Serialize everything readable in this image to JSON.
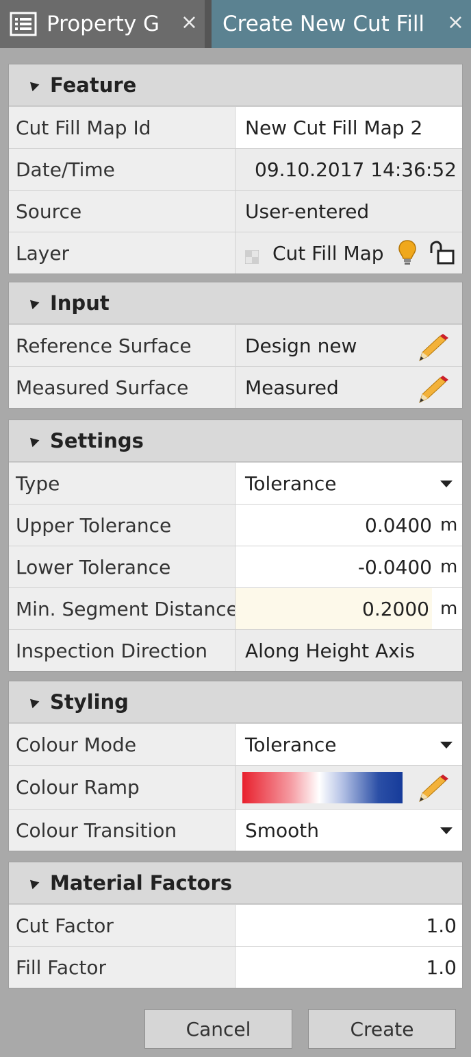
{
  "tabs": [
    {
      "label": "Property Grid",
      "close": "⨯"
    },
    {
      "label": "Create New Cut Fill Map",
      "close": "⨯"
    }
  ],
  "feature": {
    "title": "Feature",
    "rows": {
      "cut_fill_map_id": {
        "label": "Cut Fill Map Id",
        "value": "New Cut Fill Map 2"
      },
      "datetime": {
        "label": "Date/Time",
        "value": "09.10.2017 14:36:52"
      },
      "source": {
        "label": "Source",
        "value": "User-entered"
      },
      "layer": {
        "label": "Layer",
        "value": "Cut Fill Map"
      }
    }
  },
  "input": {
    "title": "Input",
    "rows": {
      "reference_surface": {
        "label": "Reference Surface",
        "value": "Design new"
      },
      "measured_surface": {
        "label": "Measured Surface",
        "value": "Measured"
      }
    }
  },
  "settings": {
    "title": "Settings",
    "rows": {
      "type": {
        "label": "Type",
        "value": "Tolerance"
      },
      "upper_tolerance": {
        "label": "Upper Tolerance",
        "value": "0.0400",
        "unit": "m"
      },
      "lower_tolerance": {
        "label": "Lower Tolerance",
        "value": "-0.0400",
        "unit": "m"
      },
      "min_segment_distance": {
        "label": "Min. Segment Distance",
        "value": "0.2000",
        "unit": "m"
      },
      "inspection_direction": {
        "label": "Inspection Direction",
        "value": "Along Height Axis"
      }
    }
  },
  "styling": {
    "title": "Styling",
    "rows": {
      "colour_mode": {
        "label": "Colour Mode",
        "value": "Tolerance"
      },
      "colour_ramp": {
        "label": "Colour Ramp"
      },
      "colour_transition": {
        "label": "Colour Transition",
        "value": "Smooth"
      }
    }
  },
  "material_factors": {
    "title": "Material Factors",
    "rows": {
      "cut_factor": {
        "label": "Cut Factor",
        "value": "1.0"
      },
      "fill_factor": {
        "label": "Fill Factor",
        "value": "1.0"
      }
    }
  },
  "buttons": {
    "cancel": "Cancel",
    "create": "Create"
  },
  "colors": {
    "tab_active": "#5b8291",
    "tab_inactive": "#6b6b6b",
    "highlight_cell": "#fdf9ea",
    "bulb": "#f0a81c",
    "ramp_start": "#e8202d",
    "ramp_end": "#163b9a"
  }
}
